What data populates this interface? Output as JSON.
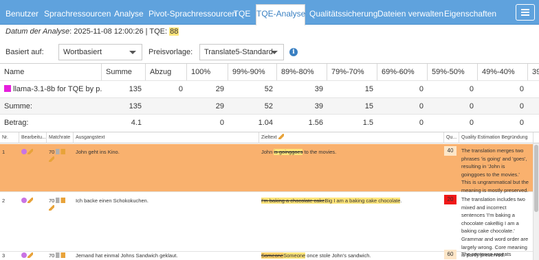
{
  "tabs": [
    {
      "label": "Benutzer"
    },
    {
      "label": "Sprachressourcen"
    },
    {
      "label": "Analyse"
    },
    {
      "label": "Pivot-Sprachressourcen"
    },
    {
      "label": "TQE"
    },
    {
      "label": "TQE-Analyse",
      "active": true
    },
    {
      "label": "Qualitätssicherung"
    },
    {
      "label": "Dateien verwalten"
    },
    {
      "label": "Eigenschaften"
    }
  ],
  "menu_icon": "hamburger-menu-icon",
  "info": {
    "date_label": "Datum der Analyse",
    "date_value": ": 2025-11-08 12:00:26 | TQE: ",
    "tqe_score": "88"
  },
  "controls": {
    "based_on_label": "Basiert auf:",
    "based_on_value": "Wortbasiert",
    "price_label": "Preisvorlage:",
    "price_value": "Translate5-Standard",
    "info_icon": "info-circle-icon"
  },
  "summary": {
    "headers": [
      "Name",
      "Summe",
      "Abzug",
      "100%",
      "99%-90%",
      "89%-80%",
      "79%-70%",
      "69%-60%",
      "59%-50%",
      "49%-40%",
      "39"
    ],
    "rows": [
      {
        "name": "llama-3.1-8b for TQE by p...",
        "values": [
          "135",
          "0",
          "29",
          "52",
          "39",
          "15",
          "0",
          "0",
          "0",
          ""
        ]
      },
      {
        "name": "Summe:",
        "values": [
          "135",
          "",
          "29",
          "52",
          "39",
          "15",
          "0",
          "0",
          "0",
          ""
        ]
      },
      {
        "name": "Betrag:",
        "values": [
          "4.1",
          "",
          "0",
          "1.04",
          "1.56",
          "1.5",
          "0",
          "0",
          "0",
          ""
        ]
      }
    ],
    "swatch_color": "#e61fdc"
  },
  "segments": {
    "headers": {
      "nr": "Nr.",
      "status": "Bearbeitu...",
      "match": "Matchrate",
      "source": "Ausgangstext",
      "target": "Zieltext",
      "quality": "Qu...",
      "reason": "Quality Estimation Begründung"
    },
    "rows": [
      {
        "nr": "1",
        "match": "70",
        "source": "John geht ins Kino.",
        "target_pre": "John ",
        "target_del": "is goinggoes",
        "target_ins": "",
        "target_post": " to the movies.",
        "quality": "40",
        "quality_color": "#fde6c8",
        "reason": "The translation merges two phrases 'is going' and 'goes', resulting in 'John is goinggoes to the movies.' This is ungrammatical but the meaning is mostly preserved."
      },
      {
        "nr": "2",
        "match": "70",
        "source": "Ich backe einen Schokokuchen.",
        "target_pre": "",
        "target_del": "I'm baking a chocolate cake",
        "target_ins": "Big I am a baking cake chocolate",
        "target_post": ".",
        "quality": "20",
        "quality_color": "#f01818",
        "reason": "The translation includes two mixed and incorrect sentences 'I'm baking a chocolate cakeBig I am a baking cake chocolate.' Grammar and word order are largely wrong. Core meaning is partly preserved."
      },
      {
        "nr": "3",
        "match": "70",
        "source": "Jemand hat einmal Johns Sandwich geklaut.",
        "target_pre": "",
        "target_del": "Someone",
        "target_ins": "Someone",
        "target_post": " once stole John's sandwich.",
        "quality": "60",
        "quality_color": "#fde6c8",
        "reason": "The sentence repeats 'Someone' unnecessarily but"
      }
    ]
  }
}
